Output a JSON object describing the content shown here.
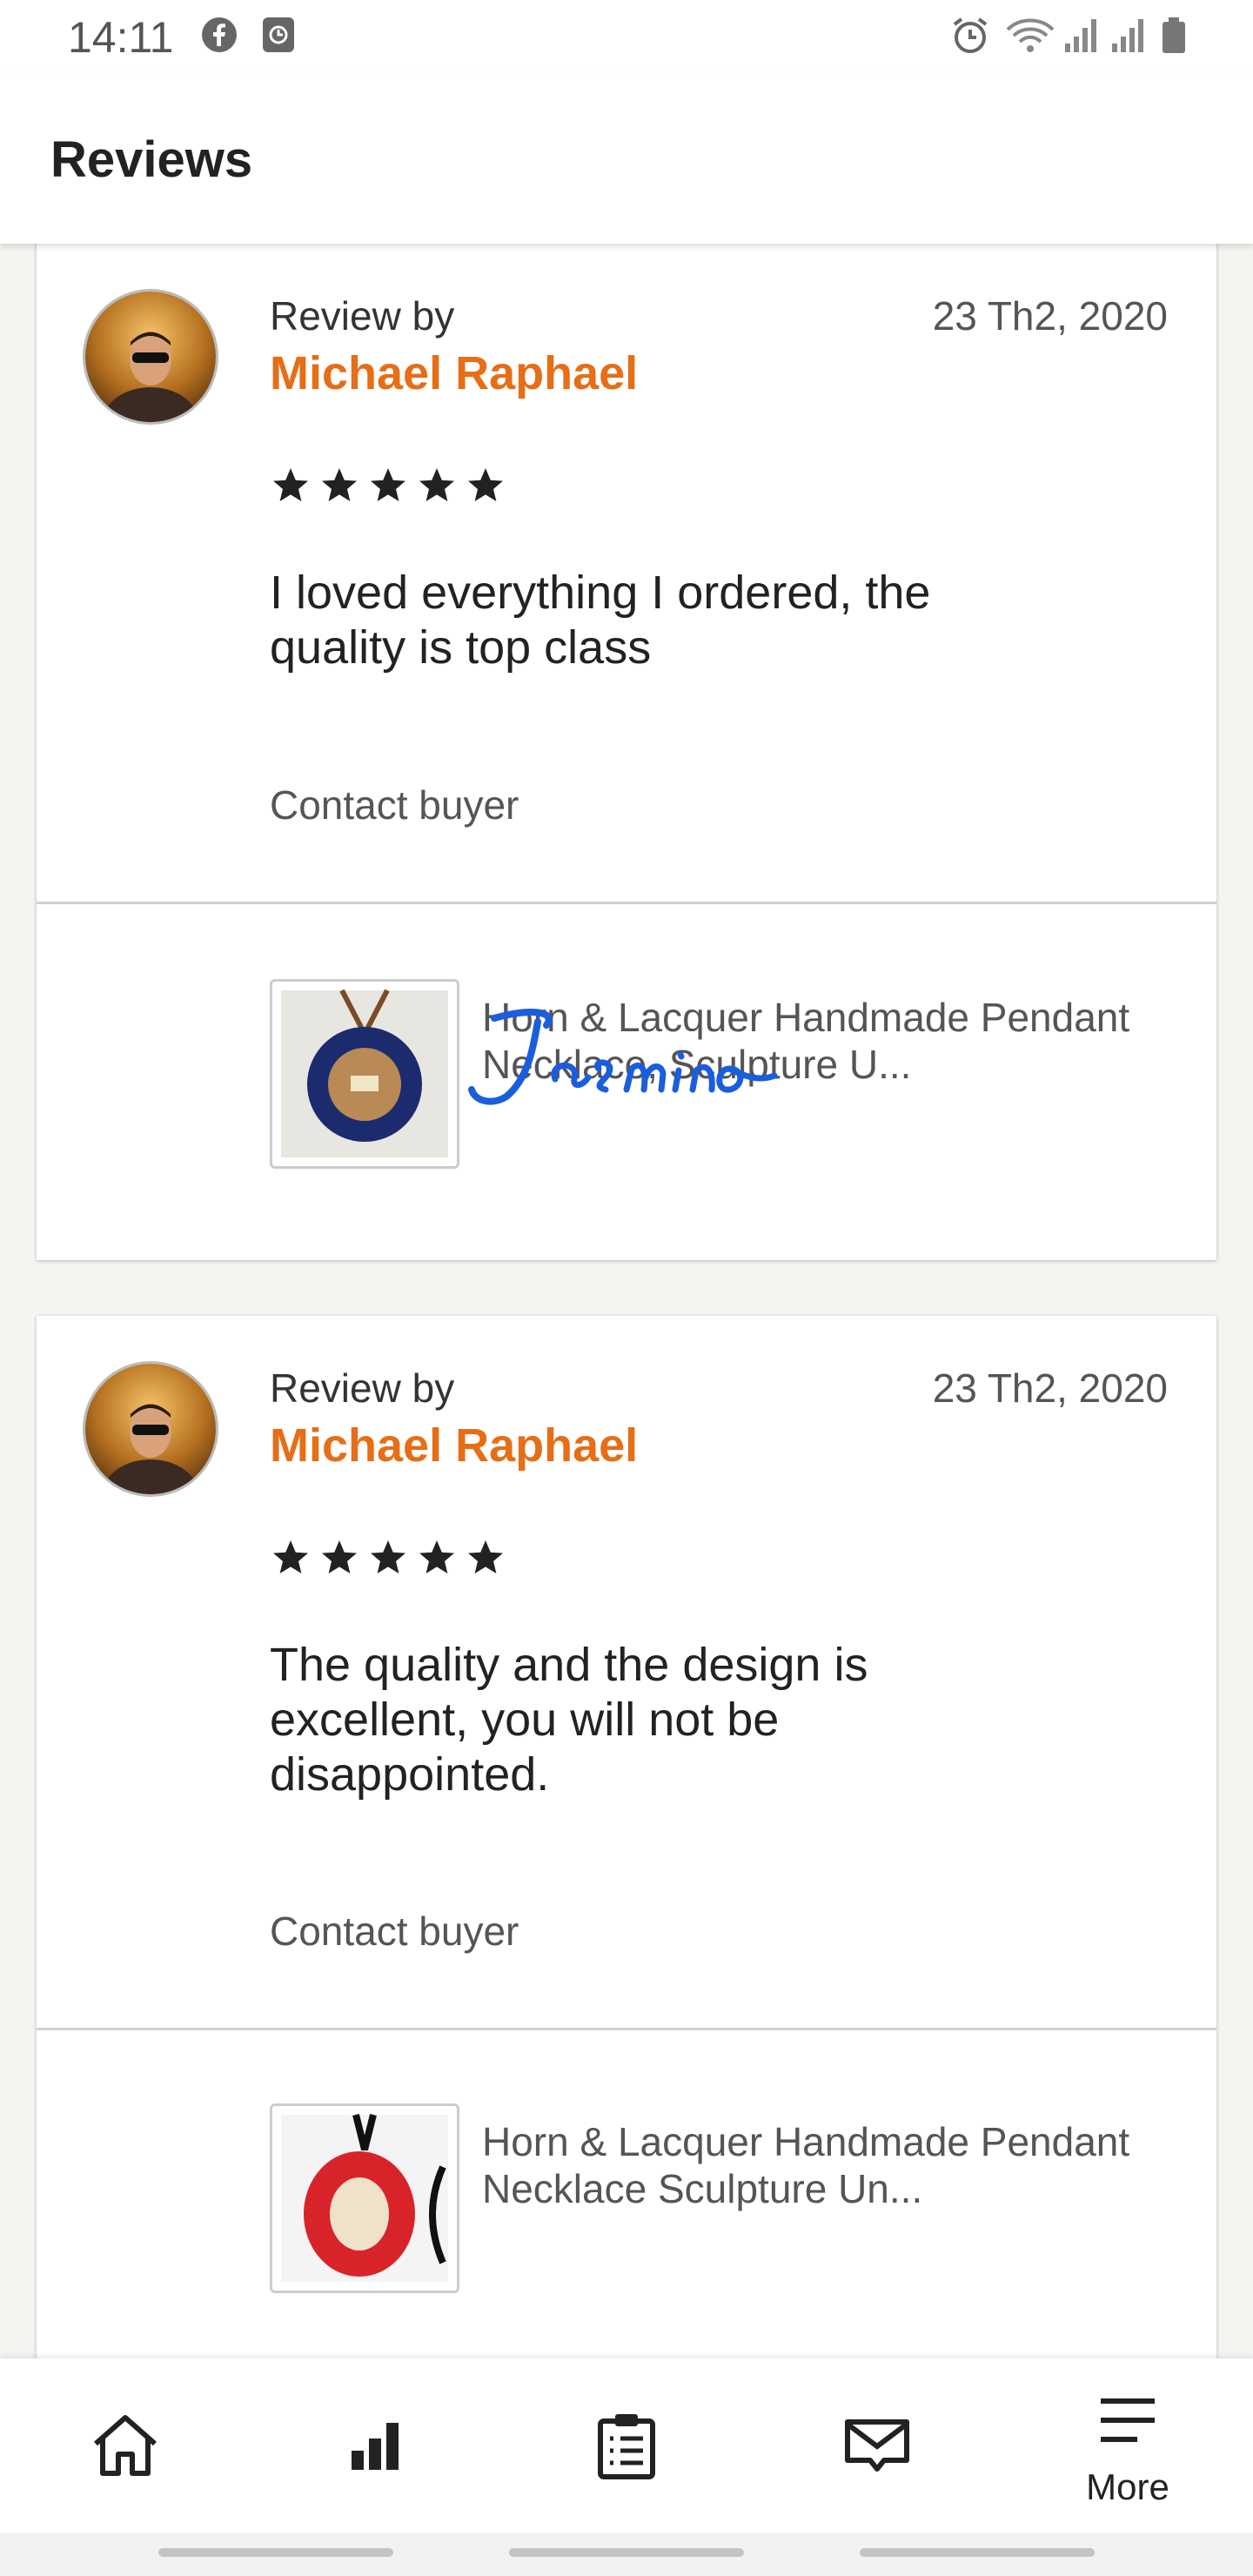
{
  "status_bar": {
    "time": "14:11",
    "left_icons": [
      "facebook-icon",
      "clock-app-icon"
    ],
    "right_icons": [
      "alarm-icon",
      "wifi-icon",
      "signal-icon",
      "signal-icon",
      "battery-icon"
    ]
  },
  "header": {
    "title": "Reviews"
  },
  "reviews": [
    {
      "review_by_label": "Review by",
      "reviewer": "Michael Raphael",
      "date": "23 Th2, 2020",
      "rating": 5,
      "text": "I loved everything I ordered, the quality is top class",
      "contact_label": "Contact buyer",
      "product_title": "Horn & Lacquer Handmade Pendant Necklace, Sculpture U...",
      "product_colors": {
        "pendant": "#1c2b6e",
        "background": "#e8e6e1"
      }
    },
    {
      "review_by_label": "Review by",
      "reviewer": "Michael Raphael",
      "date": "23 Th2, 2020",
      "rating": 5,
      "text": "The quality and the design is excellent, you will not be disappointed.",
      "contact_label": "Contact buyer",
      "product_title": "Horn & Lacquer Handmade Pendant Necklace Sculpture Un...",
      "product_colors": {
        "pendant": "#d9232a",
        "background": "#f4f4f4"
      }
    }
  ],
  "watermark": {
    "text": "Jasmino",
    "color": "#1a5ee0"
  },
  "bottom_nav": {
    "items": [
      {
        "icon": "home-icon"
      },
      {
        "icon": "stats-icon"
      },
      {
        "icon": "orders-icon"
      },
      {
        "icon": "messages-icon"
      },
      {
        "icon": "menu-icon",
        "label": "More"
      }
    ]
  },
  "colors": {
    "accent": "#e56e17",
    "background": "#f5f4f1"
  }
}
